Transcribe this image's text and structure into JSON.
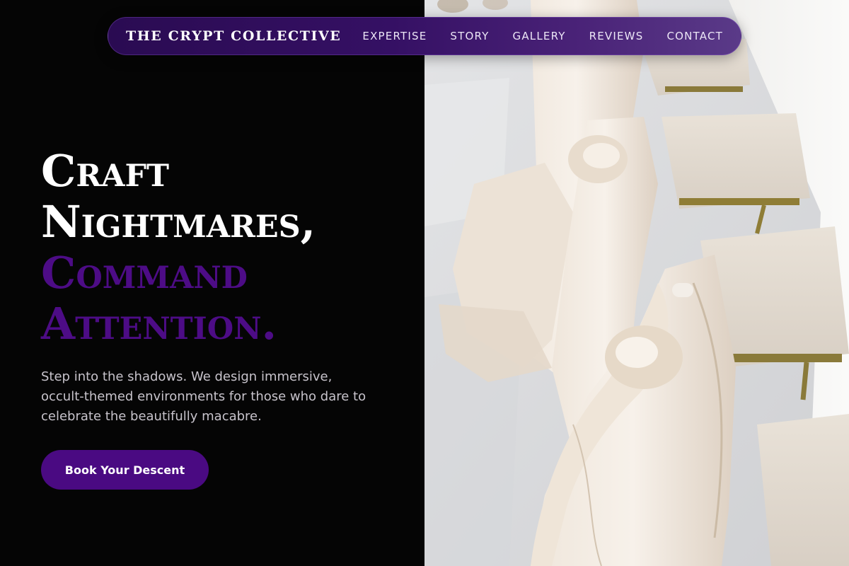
{
  "nav": {
    "brand": "THE CRYPT COLLECTIVE",
    "links": [
      "EXPERTISE",
      "STORY",
      "GALLERY",
      "REVIEWS",
      "CONTACT"
    ]
  },
  "hero": {
    "title_lines": [
      "Craft",
      "Nightmares,",
      "Command",
      "Attention."
    ],
    "subtitle": "Step into the shadows. We design immersive, occult-themed environments for those who dare to celebrate the beautifully macabre.",
    "cta_label": "Book Your Descent",
    "image_alt": "Chairs draped in ivory chiffon sashes lining a banquet table"
  },
  "colors": {
    "background": "#050505",
    "accent_purple": "#4d0c86",
    "button_purple": "#4a0a82",
    "nav_purple": "#351064",
    "text_white": "#ffffff",
    "text_muted": "#c7c3cb"
  },
  "icons": [
    "photo-chair-sash-image"
  ]
}
